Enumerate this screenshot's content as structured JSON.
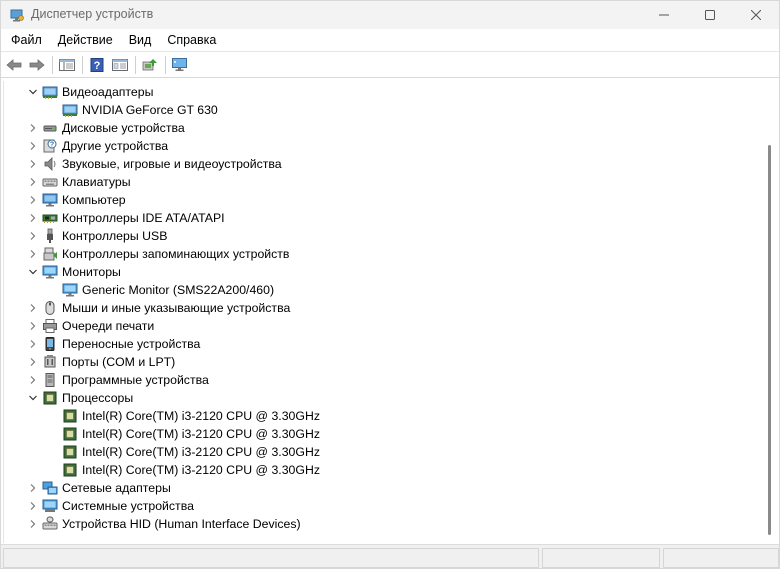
{
  "window": {
    "title": "Диспетчер устройств"
  },
  "menu": [
    "Файл",
    "Действие",
    "Вид",
    "Справка"
  ],
  "toolbar": {
    "buttons": [
      "back-icon",
      "forward-icon",
      "properties-view-icon",
      "help-icon",
      "details-view-icon",
      "update-driver-icon",
      "monitor-scan-icon"
    ]
  },
  "tree": [
    {
      "label": "Видеоадаптеры",
      "level": 0,
      "expanded": true,
      "icon": "display-adapter-icon"
    },
    {
      "label": "NVIDIA GeForce GT 630",
      "level": 1,
      "icon": "display-adapter-icon"
    },
    {
      "label": "Дисковые устройства",
      "level": 0,
      "expanded": false,
      "icon": "disk-drive-icon"
    },
    {
      "label": "Другие устройства",
      "level": 0,
      "expanded": false,
      "icon": "unknown-device-icon"
    },
    {
      "label": "Звуковые, игровые и видеоустройства",
      "level": 0,
      "expanded": false,
      "icon": "speaker-icon"
    },
    {
      "label": "Клавиатуры",
      "level": 0,
      "expanded": false,
      "icon": "keyboard-icon"
    },
    {
      "label": "Компьютер",
      "level": 0,
      "expanded": false,
      "icon": "computer-icon"
    },
    {
      "label": "Контроллеры IDE ATA/ATAPI",
      "level": 0,
      "expanded": false,
      "icon": "ide-controller-icon"
    },
    {
      "label": "Контроллеры USB",
      "level": 0,
      "expanded": false,
      "icon": "usb-icon"
    },
    {
      "label": "Контроллеры запоминающих устройств",
      "level": 0,
      "expanded": false,
      "icon": "storage-controller-icon"
    },
    {
      "label": "Мониторы",
      "level": 0,
      "expanded": true,
      "icon": "monitor-icon"
    },
    {
      "label": "Generic Monitor (SMS22A200/460)",
      "level": 1,
      "icon": "monitor-icon"
    },
    {
      "label": "Мыши и иные указывающие устройства",
      "level": 0,
      "expanded": false,
      "icon": "mouse-icon"
    },
    {
      "label": "Очереди печати",
      "level": 0,
      "expanded": false,
      "icon": "printer-icon"
    },
    {
      "label": "Переносные устройства",
      "level": 0,
      "expanded": false,
      "icon": "portable-device-icon"
    },
    {
      "label": "Порты (COM и LPT)",
      "level": 0,
      "expanded": false,
      "icon": "port-icon"
    },
    {
      "label": "Программные устройства",
      "level": 0,
      "expanded": false,
      "icon": "software-device-icon"
    },
    {
      "label": "Процессоры",
      "level": 0,
      "expanded": true,
      "icon": "processor-icon"
    },
    {
      "label": "Intel(R) Core(TM) i3-2120 CPU @ 3.30GHz",
      "level": 1,
      "icon": "processor-icon"
    },
    {
      "label": "Intel(R) Core(TM) i3-2120 CPU @ 3.30GHz",
      "level": 1,
      "icon": "processor-icon"
    },
    {
      "label": "Intel(R) Core(TM) i3-2120 CPU @ 3.30GHz",
      "level": 1,
      "icon": "processor-icon"
    },
    {
      "label": "Intel(R) Core(TM) i3-2120 CPU @ 3.30GHz",
      "level": 1,
      "icon": "processor-icon"
    },
    {
      "label": "Сетевые адаптеры",
      "level": 0,
      "expanded": false,
      "icon": "network-adapter-icon"
    },
    {
      "label": "Системные устройства",
      "level": 0,
      "expanded": false,
      "icon": "system-device-icon"
    },
    {
      "label": "Устройства HID (Human Interface Devices)",
      "level": 0,
      "expanded": false,
      "icon": "hid-icon"
    }
  ]
}
